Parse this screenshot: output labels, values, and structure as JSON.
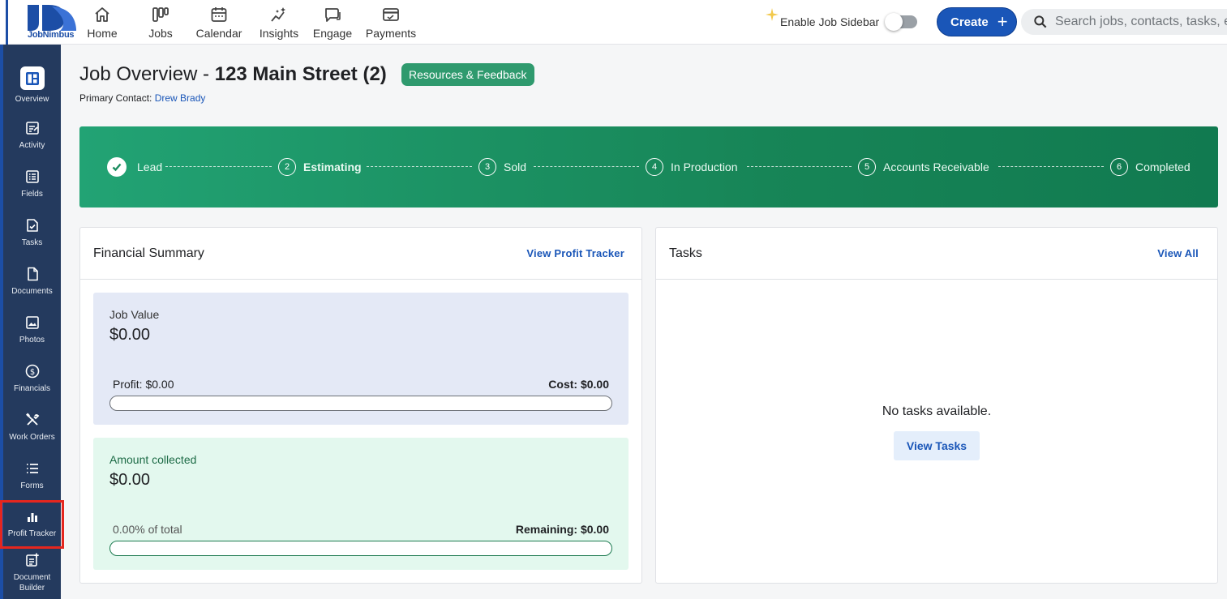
{
  "brand": {
    "name": "JobNimbus",
    "color": "#1c4ea6"
  },
  "topnav": [
    {
      "label": "Home",
      "icon": "home-icon"
    },
    {
      "label": "Jobs",
      "icon": "jobs-icon"
    },
    {
      "label": "Calendar",
      "icon": "calendar-icon"
    },
    {
      "label": "Insights",
      "icon": "insights-icon"
    },
    {
      "label": "Engage",
      "icon": "engage-icon"
    },
    {
      "label": "Payments",
      "icon": "payments-icon"
    }
  ],
  "header": {
    "sidebar_toggle_label": "Enable Job Sidebar",
    "sidebar_toggle_on": false,
    "create_label": "Create",
    "search_placeholder": "Search jobs, contacts, tasks, etc."
  },
  "sidebar": {
    "items": [
      {
        "label": "Overview",
        "icon": "overview-icon",
        "active": true
      },
      {
        "label": "Activity",
        "icon": "activity-icon"
      },
      {
        "label": "Fields",
        "icon": "fields-icon"
      },
      {
        "label": "Tasks",
        "icon": "tasks-icon"
      },
      {
        "label": "Documents",
        "icon": "documents-icon"
      },
      {
        "label": "Photos",
        "icon": "photos-icon"
      },
      {
        "label": "Financials",
        "icon": "financials-icon"
      },
      {
        "label": "Work Orders",
        "icon": "work-orders-icon"
      },
      {
        "label": "Forms",
        "icon": "forms-icon"
      },
      {
        "label": "Profit Tracker",
        "icon": "profit-tracker-icon",
        "highlighted": true
      },
      {
        "label": "Document Builder",
        "icon": "document-builder-icon"
      }
    ]
  },
  "job": {
    "title_prefix": "Job Overview - ",
    "title_name": "123 Main Street (2)",
    "resources_label": "Resources & Feedback",
    "primary_contact_label": "Primary Contact: ",
    "primary_contact_name": "Drew Brady"
  },
  "stages": [
    {
      "num": "",
      "name": "Lead",
      "done": true
    },
    {
      "num": "2",
      "name": "Estimating",
      "current": true
    },
    {
      "num": "3",
      "name": "Sold"
    },
    {
      "num": "4",
      "name": "In Production"
    },
    {
      "num": "5",
      "name": "Accounts Receivable"
    },
    {
      "num": "6",
      "name": "Completed"
    }
  ],
  "financial": {
    "title": "Financial Summary",
    "link": "View Profit Tracker",
    "job_value_label": "Job Value",
    "job_value": "$0.00",
    "profit": "Profit: $0.00",
    "cost": "Cost: $0.00",
    "profit_fraction": 0,
    "collected_label": "Amount collected",
    "collected_value": "$0.00",
    "pct_of_total": "0.00% of total",
    "remaining": "Remaining: $0.00",
    "collected_fraction": 0
  },
  "tasks": {
    "title": "Tasks",
    "link": "View All",
    "empty_text": "No tasks available.",
    "view_button": "View Tasks"
  },
  "colors": {
    "accent_blue": "#1a56b8",
    "stage_green": "#178557",
    "resources_green": "#2f9a6e",
    "job_value_bg": "#e4e9f6",
    "collected_bg": "#e3f8ee",
    "highlight_red": "#e5261e"
  }
}
